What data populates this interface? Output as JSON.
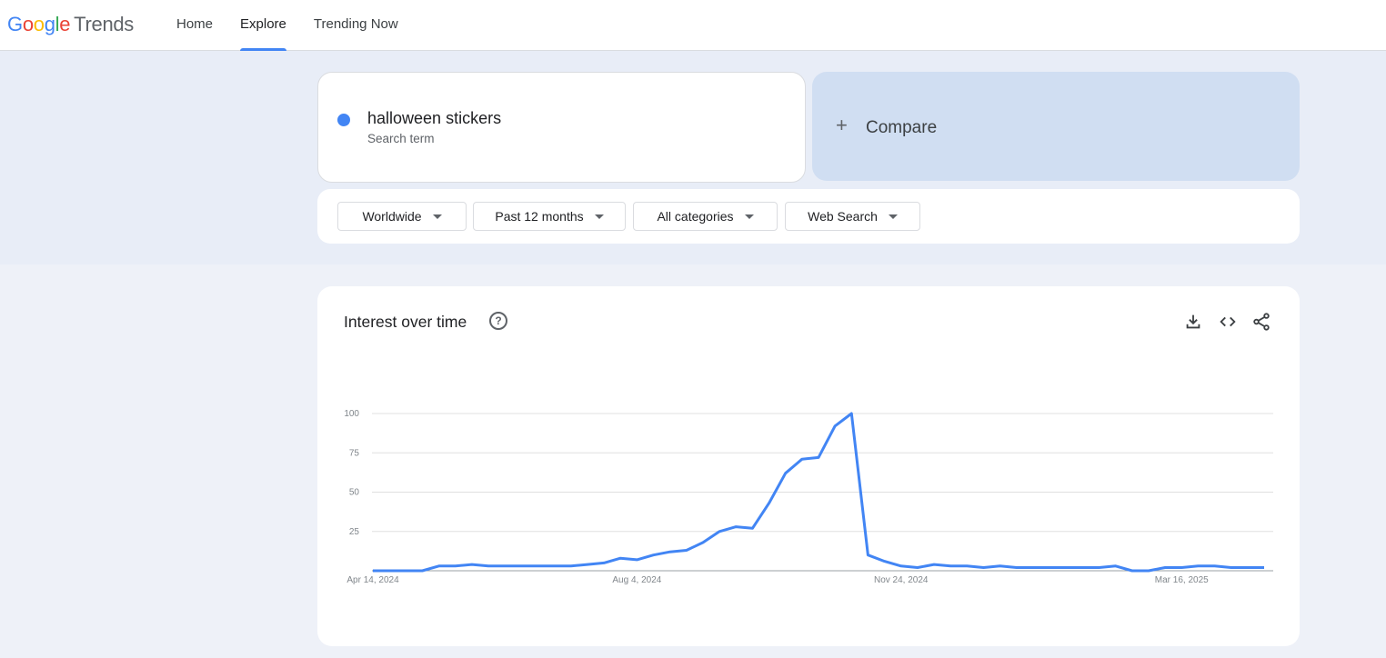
{
  "header": {
    "logo_google": "Google",
    "logo_product": "Trends",
    "nav": [
      {
        "label": "Home",
        "active": false
      },
      {
        "label": "Explore",
        "active": true
      },
      {
        "label": "Trending Now",
        "active": false
      }
    ]
  },
  "search": {
    "term": "halloween stickers",
    "term_type": "Search term",
    "term_color": "#4285f4",
    "compare_label": "Compare"
  },
  "filters": {
    "region": "Worldwide",
    "time_range": "Past 12 months",
    "category": "All categories",
    "search_type": "Web Search"
  },
  "chart_panel": {
    "title": "Interest over time",
    "icons": [
      "help-icon",
      "download-icon",
      "embed-code-icon",
      "share-icon"
    ]
  },
  "chart_data": {
    "type": "line",
    "x_tick_labels": [
      "Apr 14, 2024",
      "Aug 4, 2024",
      "Nov 24, 2024",
      "Mar 16, 2025"
    ],
    "y_tick_labels": [
      "25",
      "50",
      "75",
      "100"
    ],
    "ylim": [
      0,
      100
    ],
    "grid": true,
    "series": [
      {
        "name": "halloween stickers",
        "color": "#4285f4",
        "values": [
          0,
          0,
          0,
          0,
          3,
          3,
          4,
          3,
          3,
          3,
          3,
          3,
          3,
          4,
          5,
          8,
          7,
          10,
          12,
          13,
          18,
          25,
          28,
          27,
          43,
          62,
          71,
          72,
          92,
          100,
          10,
          6,
          3,
          2,
          4,
          3,
          3,
          2,
          3,
          2,
          2,
          2,
          2,
          2,
          2,
          3,
          0,
          0,
          2,
          2,
          3,
          3,
          2,
          2,
          2
        ]
      }
    ]
  }
}
